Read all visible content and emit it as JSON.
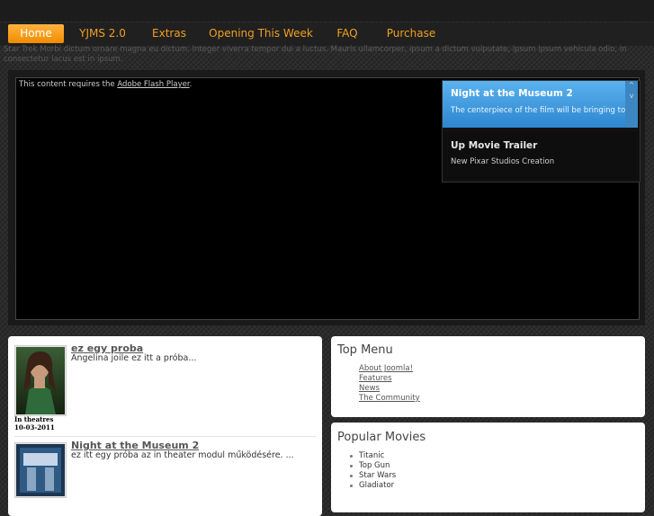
{
  "nav": {
    "items": [
      "Home",
      "YJMS 2.0",
      "Extras",
      "Opening This Week",
      "FAQ",
      "Purchase"
    ]
  },
  "intro_text": "Star Trek Morbi dictum ornare magna eu dictum. Integer viverra tempor dui a luctus. Mauris ullamcorper, ipsum a dictum vulputate, ipsum ipsum vehicula odio, in consectetur lacus est in ipsum.",
  "flash": {
    "notice_prefix": "This content requires the ",
    "notice_link": "Adobe Flash Player",
    "notice_suffix": "."
  },
  "slider": {
    "slides": [
      {
        "title": "Night at the Museum 2",
        "desc": "The centerpiece of the film will be bringing to life"
      },
      {
        "title": "Up Movie Trailer",
        "desc": "New Pixar Studios Creation"
      }
    ],
    "up_arrow": "^",
    "down_arrow": "v"
  },
  "news": {
    "articles": [
      {
        "title": "ez egy proba",
        "text": " Angelina joile ez itt a próba...",
        "caption": "In theatres 10-03-2011"
      },
      {
        "title": "Night at the Museum 2",
        "text": "ez itt egy próba az in theater modul működésére.  ..."
      }
    ]
  },
  "top_menu": {
    "title": "Top Menu",
    "links": [
      "About Joomla!",
      "Features",
      "News",
      "The Community"
    ]
  },
  "popular": {
    "title": "Popular Movies",
    "items": [
      "Titanic",
      "Top Gun",
      "Star Wars",
      "Gladiator"
    ]
  },
  "colors": {
    "nav_text": "#f0a020",
    "nav_active": "#f59a10",
    "slide_active": "#3d95dc"
  }
}
